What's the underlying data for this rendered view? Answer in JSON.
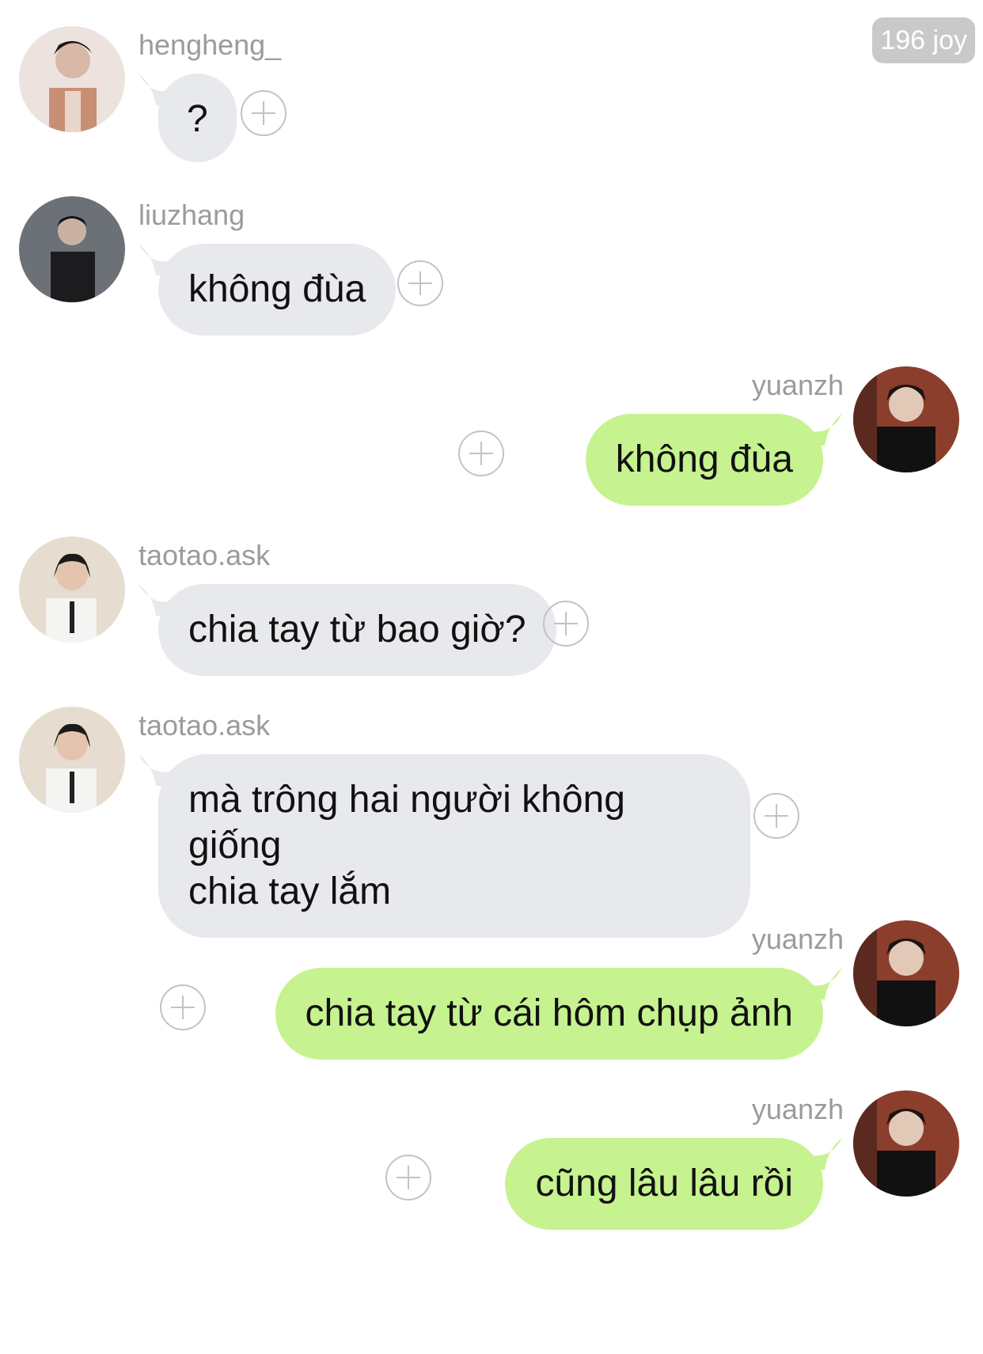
{
  "header": {
    "joy_badge": "196 joy"
  },
  "colors": {
    "incoming_bubble": "#e8e9ec",
    "outgoing_bubble": "#c6f28f",
    "username_text": "#9b9b9f",
    "badge_bg": "#c9c9cb"
  },
  "messages": [
    {
      "sender": "hengheng_",
      "text": "?",
      "side": "left",
      "avatar": "hengheng-avatar"
    },
    {
      "sender": "liuzhang",
      "text": "không đùa",
      "side": "left",
      "avatar": "liuzhang-avatar"
    },
    {
      "sender": "yuanzh",
      "text": "không đùa",
      "side": "right",
      "avatar": "yuanzh-avatar"
    },
    {
      "sender": "taotao.ask",
      "text": "chia tay từ bao giờ?",
      "side": "left",
      "avatar": "taotao-avatar"
    },
    {
      "sender": "taotao.ask",
      "text": "mà trông hai người không giống\nchia tay lắm",
      "side": "left",
      "avatar": "taotao-avatar"
    },
    {
      "sender": "yuanzh",
      "text": "chia tay từ cái hôm chụp ảnh",
      "side": "right",
      "avatar": "yuanzh-avatar"
    },
    {
      "sender": "yuanzh",
      "text": "cũng lâu lâu rồi",
      "side": "right",
      "avatar": "yuanzh-avatar"
    }
  ]
}
